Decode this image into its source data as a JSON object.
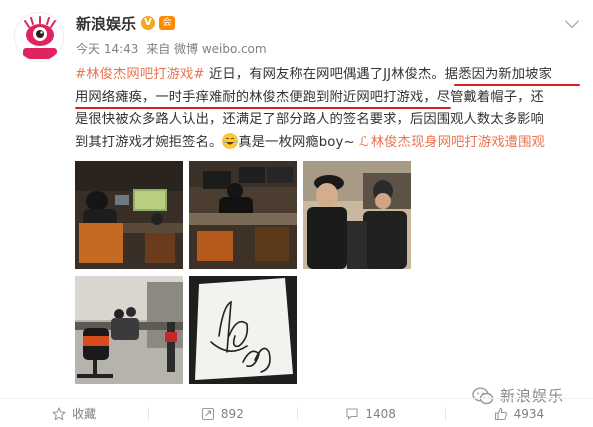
{
  "account": {
    "name": "新浪娱乐",
    "verified_badge": "V",
    "member_badge": "会",
    "avatar_text": "新浪娱乐"
  },
  "meta": {
    "time": "今天 14:43",
    "source": "来自 微博 weibo.com"
  },
  "post": {
    "line1": {
      "hashtag": "#林俊杰网吧打游戏#",
      "plain": " 近日，有网友称在网吧偶遇了JJ林俊杰。",
      "underlined": "据悉因为新加坡家"
    },
    "line2": {
      "underlined": "用网络瘫痪，一时手痒难耐的林俊杰便跑到附近网吧打游戏，",
      "plain": "尽管戴着帽子，还"
    },
    "line3": "是很快被众多路人认出，还满足了部分路人的签名要求，后因围观人数太多影响",
    "line4": {
      "plain": "到其打游戏才婉拒签名。",
      "after_emoji": "真是一枚网瘾boy~ ",
      "link_icon": "ℒ",
      "link": "林俊杰现身网吧打游戏遭围观"
    }
  },
  "watermark": "新浪娱乐",
  "actions": [
    {
      "label": "收藏",
      "icon": "star-icon"
    },
    {
      "label": "892",
      "icon": "share-icon"
    },
    {
      "label": "1408",
      "icon": "comment-icon"
    },
    {
      "label": "4934",
      "icon": "like-icon"
    }
  ],
  "colors": {
    "link": "#eb7350",
    "annotation_underline": "#d82020",
    "meta_text": "#808080"
  }
}
